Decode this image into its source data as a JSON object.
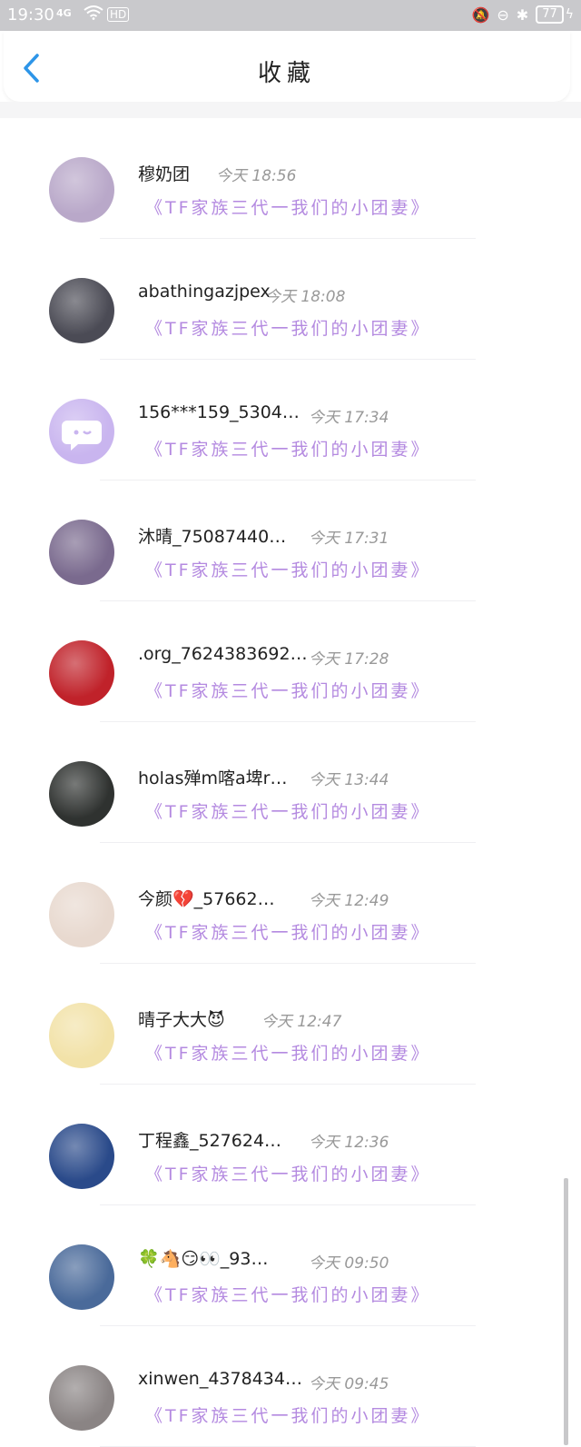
{
  "status_bar": {
    "time": "19:30",
    "signal": "4G",
    "hd": "HD",
    "battery": "77"
  },
  "header": {
    "title": "收藏",
    "back_icon": "chevron-left-icon"
  },
  "colors": {
    "accent_back": "#2d95e8",
    "link_purple": "#b48ae0",
    "status_bar": "#c9c9cc"
  },
  "favorites": [
    {
      "name": "穆奶团",
      "time": "今天 18:56",
      "link": "《TF家族三代一我们的小团妻》",
      "avatar_color": "#b9a8c9"
    },
    {
      "name": "abathingazjpex",
      "time": "今天 18:08",
      "link": "《TF家族三代一我们的小团妻》",
      "avatar_color": "#4b4b55"
    },
    {
      "name": "156***159_5304…",
      "time": "今天 17:34",
      "link": "《TF家族三代一我们的小团妻》",
      "avatar_color": "#c9b5ef"
    },
    {
      "name": "沐晴_75087440…",
      "time": "今天 17:31",
      "link": "《TF家族三代一我们的小团妻》",
      "avatar_color": "#7a6a8e"
    },
    {
      "name": ".org_7624383692…",
      "time": "今天 17:28",
      "link": "《TF家族三代一我们的小团妻》",
      "avatar_color": "#c0222a"
    },
    {
      "name": "holas殚m喀a埤r…",
      "time": "今天 13:44",
      "link": "《TF家族三代一我们的小团妻》",
      "avatar_color": "#2f3230"
    },
    {
      "name": "今颜💔_57662…",
      "time": "今天 12:49",
      "link": "《TF家族三代一我们的小团妻》",
      "avatar_color": "#e8d9cf"
    },
    {
      "name": "晴子大大😈",
      "time": "今天 12:47",
      "link": "《TF家族三代一我们的小团妻》",
      "avatar_color": "#f2e2a8"
    },
    {
      "name": "丁程鑫_527624…",
      "time": "今天 12:36",
      "link": "《TF家族三代一我们的小团妻》",
      "avatar_color": "#2a4a8a"
    },
    {
      "name": "🍀🐴😏👀_93…",
      "time": "今天 09:50",
      "link": "《TF家族三代一我们的小团妻》",
      "avatar_color": "#4a6a9a"
    },
    {
      "name": "xinwen_4378434…",
      "time": "今天 09:45",
      "link": "《TF家族三代一我们的小团妻》",
      "avatar_color": "#8a8484"
    }
  ]
}
